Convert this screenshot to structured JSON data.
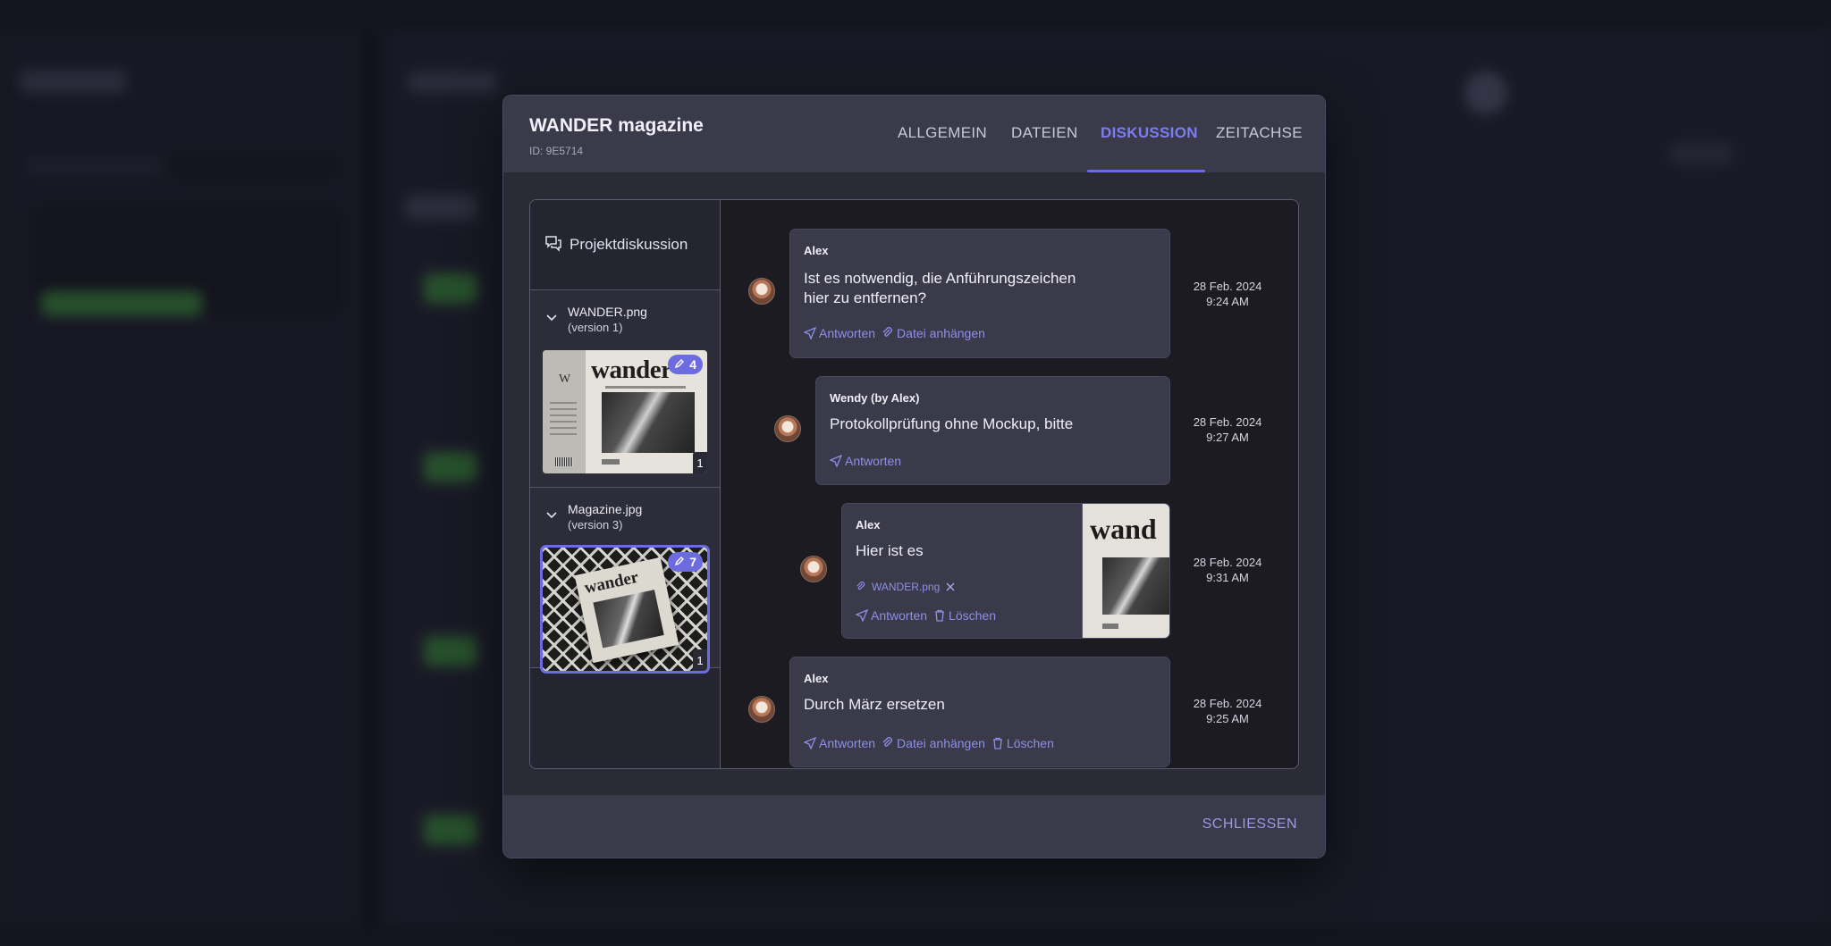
{
  "modal": {
    "title": "WANDER magazine",
    "id_label": "ID: 9E5714",
    "tabs": [
      {
        "label": "ALLGEMEIN"
      },
      {
        "label": "DATEIEN"
      },
      {
        "label": "DISKUSSION"
      },
      {
        "label": "ZEITACHSE"
      }
    ],
    "active_tab": "DISKUSSION",
    "close_label": "SCHLIESSEN"
  },
  "files_panel": {
    "project_discussion_label": "Projektdiskussion",
    "files": [
      {
        "name": "WANDER.png",
        "version": "(version 1)",
        "annotation_count": "4",
        "version_number": "1",
        "cover_title": "wander",
        "cover_letter": "W"
      },
      {
        "name": "Magazine.jpg",
        "version": "(version 3)",
        "annotation_count": "7",
        "version_number": "1",
        "cover_title": "wander",
        "selected": true
      }
    ]
  },
  "messages": [
    {
      "author": "Alex",
      "text_line1": "Ist es notwendig, die Anführungszeichen",
      "text_line2": "hier zu entfernen?",
      "date": "28 Feb. 2024",
      "time": "9:24 AM",
      "actions": [
        "Antworten",
        "Datei anhängen"
      ]
    },
    {
      "author": "Wendy (by Alex)",
      "text": "Protokollprüfung ohne Mockup, bitte",
      "date": "28 Feb. 2024",
      "time": "9:27 AM",
      "actions": [
        "Antworten"
      ]
    },
    {
      "author": "Alex",
      "text": "Hier ist es",
      "attachment": "WANDER.png",
      "attachment_cover_title": "wand",
      "date": "28 Feb. 2024",
      "time": "9:31 AM",
      "actions": [
        "Antworten",
        "Löschen"
      ]
    },
    {
      "author": "Alex",
      "text": "Durch März ersetzen",
      "date": "28 Feb. 2024",
      "time": "9:25 AM",
      "actions": [
        "Antworten",
        "Datei anhängen",
        "Löschen"
      ]
    }
  ],
  "colors": {
    "accent": "#6c6be0",
    "modal_bg": "#2b2b36",
    "header_bg": "#3a3a4b",
    "bubble_bg": "#3a3a4a",
    "link": "#8f8ee6"
  }
}
